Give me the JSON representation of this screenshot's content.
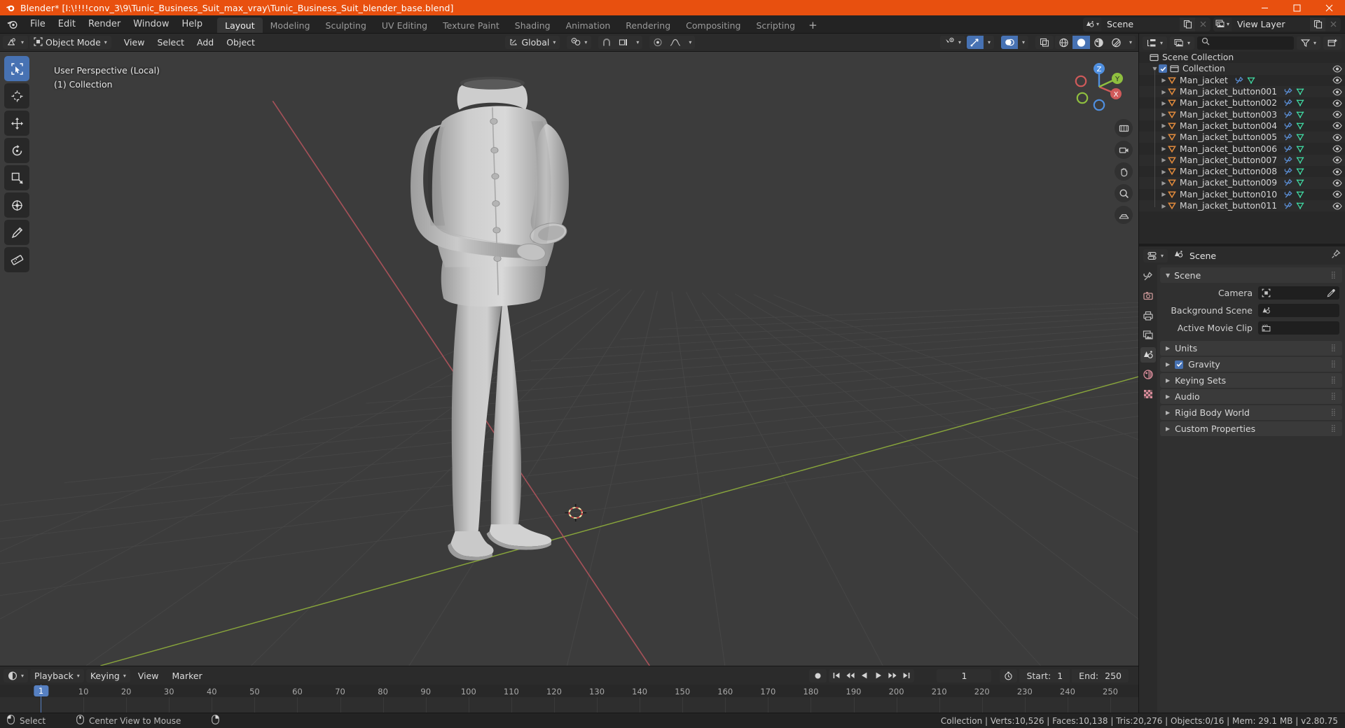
{
  "titlebar": {
    "text": "Blender* [I:\\!!!!conv_3\\9\\Tunic_Business_Suit_max_vray\\Tunic_Business_Suit_blender_base.blend]",
    "logo_icon": "blender-logo-icon",
    "minimize_icon": "minimize-icon",
    "maximize_icon": "maximize-icon",
    "close_icon": "close-icon",
    "bg_color": "#e8500f"
  },
  "topbar": {
    "logo_icon": "blender-logo-icon",
    "menus": [
      "File",
      "Edit",
      "Render",
      "Window",
      "Help"
    ],
    "workspace_tabs": [
      {
        "label": "Layout",
        "active": true
      },
      {
        "label": "Modeling",
        "active": false
      },
      {
        "label": "Sculpting",
        "active": false
      },
      {
        "label": "UV Editing",
        "active": false
      },
      {
        "label": "Texture Paint",
        "active": false
      },
      {
        "label": "Shading",
        "active": false
      },
      {
        "label": "Animation",
        "active": false
      },
      {
        "label": "Rendering",
        "active": false
      },
      {
        "label": "Compositing",
        "active": false
      },
      {
        "label": "Scripting",
        "active": false
      }
    ],
    "add_workspace_label": "+",
    "scene": {
      "icon": "scene-icon",
      "name": "Scene",
      "copy_icon": "new-scene-icon",
      "unlink_icon": "unlink-icon"
    },
    "view_layer": {
      "icon": "view-layer-icon",
      "name": "View Layer",
      "copy_icon": "new-view-layer-icon",
      "unlink_icon": "unlink-icon"
    }
  },
  "viewport_header": {
    "editor_type_icon": "editor-type-3dview-icon",
    "mode": "Object Mode",
    "mode_icon": "object-mode-icon",
    "menus": [
      "View",
      "Select",
      "Add",
      "Object"
    ],
    "transform_orientation": {
      "icon": "orientation-global-icon",
      "label": "Global"
    },
    "pivot_icon": "pivot-point-icon",
    "snap_icon": "snap-magnet-icon",
    "snap_target_icon": "snap-increment-icon",
    "proportional_icon": "proportional-editing-icon",
    "falloff_icon": "falloff-smooth-icon",
    "visibility_icon": "object-visibility-icon",
    "gizmo_icon": "gizmo-icon",
    "overlays_icon": "overlays-icon",
    "xray_icon": "xray-toggle-icon",
    "shading_modes": [
      {
        "name": "wireframe",
        "icon": "shading-wireframe-icon",
        "active": false
      },
      {
        "name": "solid",
        "icon": "shading-solid-icon",
        "active": true
      },
      {
        "name": "material",
        "icon": "shading-material-icon",
        "active": false
      },
      {
        "name": "rendered",
        "icon": "shading-rendered-icon",
        "active": false
      }
    ]
  },
  "viewport": {
    "overlay_line1": "User Perspective (Local)",
    "overlay_line2": "(1) Collection",
    "background_color": "#3c3c3c",
    "grid_color": "#4a4a4a",
    "axis_x_color": "#c75b64",
    "axis_y_color": "#9acd32",
    "tools": [
      {
        "name": "tweak-select-box-tool",
        "icon": "select-box-icon",
        "active": true
      },
      {
        "name": "cursor-tool",
        "icon": "3d-cursor-icon",
        "active": false
      },
      {
        "name": "move-tool",
        "icon": "move-arrows-icon",
        "active": false
      },
      {
        "name": "rotate-tool",
        "icon": "rotate-icon",
        "active": false
      },
      {
        "name": "scale-tool",
        "icon": "scale-icon",
        "active": false
      },
      {
        "name": "transform-tool",
        "icon": "transform-icon",
        "active": false
      },
      {
        "name": "annotate-tool",
        "icon": "annotate-pencil-icon",
        "active": false
      },
      {
        "name": "measure-tool",
        "icon": "measure-ruler-icon",
        "active": false
      }
    ],
    "gizmo": {
      "axis_labels": [
        "X",
        "Y",
        "Z"
      ],
      "x_color": "#e05a5a",
      "y_color": "#8fbf3f",
      "z_color": "#4f8fe0"
    },
    "nav_buttons": [
      {
        "name": "zoom-region-button",
        "icon": "zoom-icon"
      },
      {
        "name": "camera-view-button",
        "icon": "camera-icon"
      },
      {
        "name": "move-view-button",
        "icon": "hand-icon"
      },
      {
        "name": "zoom-view-button",
        "icon": "magnifier-icon"
      },
      {
        "name": "toggle-perspective-button",
        "icon": "perspective-grid-icon"
      }
    ]
  },
  "timeline": {
    "editor_type_icon": "editor-type-timeline-icon",
    "menus": [
      "Playback",
      "Keying",
      "View",
      "Marker"
    ],
    "record_icon": "record-keyframe-icon",
    "transport": [
      {
        "name": "jump-to-start-button",
        "icon": "jump-start-icon"
      },
      {
        "name": "previous-keyframe-button",
        "icon": "prev-keyframe-icon"
      },
      {
        "name": "play-reverse-button",
        "icon": "play-reverse-icon"
      },
      {
        "name": "play-button",
        "icon": "play-icon"
      },
      {
        "name": "next-keyframe-button",
        "icon": "next-keyframe-icon"
      },
      {
        "name": "jump-to-end-button",
        "icon": "jump-end-icon"
      }
    ],
    "current_frame": "1",
    "use_preview_range_icon": "stopwatch-icon",
    "start_label": "Start:",
    "start_value": "1",
    "end_label": "End:",
    "end_value": "250",
    "ruler_ticks": [
      "1",
      "10",
      "20",
      "30",
      "40",
      "50",
      "60",
      "70",
      "80",
      "90",
      "100",
      "110",
      "120",
      "130",
      "140",
      "150",
      "160",
      "170",
      "180",
      "190",
      "200",
      "210",
      "220",
      "230",
      "240",
      "250"
    ],
    "playhead_frame": "1",
    "playhead_color": "#5680c2"
  },
  "outliner": {
    "display_mode_icon": "outliner-display-mode-icon",
    "view_layer_icon": "view-layer-icon",
    "search_icon": "search-icon",
    "search_placeholder": "",
    "search_value": "",
    "filter_icon": "filter-funnel-icon",
    "new_collection_icon": "new-collection-icon",
    "rows": [
      {
        "label": "Scene Collection",
        "depth": 0,
        "icon": "scene-collection-icon",
        "expander": "",
        "checkbox": false,
        "modifier": false,
        "mesh": false,
        "eye": false
      },
      {
        "label": "Collection",
        "depth": 1,
        "icon": "collection-icon",
        "expander": "down",
        "checkbox": true,
        "modifier": false,
        "mesh": false,
        "eye": true
      },
      {
        "label": "Man_jacket",
        "depth": 2,
        "icon": "mesh-object-icon",
        "expander": "right",
        "checkbox": false,
        "modifier": true,
        "mesh": true,
        "eye": true
      },
      {
        "label": "Man_jacket_button001",
        "depth": 2,
        "icon": "mesh-object-icon",
        "expander": "right",
        "checkbox": false,
        "modifier": true,
        "mesh": true,
        "eye": true
      },
      {
        "label": "Man_jacket_button002",
        "depth": 2,
        "icon": "mesh-object-icon",
        "expander": "right",
        "checkbox": false,
        "modifier": true,
        "mesh": true,
        "eye": true
      },
      {
        "label": "Man_jacket_button003",
        "depth": 2,
        "icon": "mesh-object-icon",
        "expander": "right",
        "checkbox": false,
        "modifier": true,
        "mesh": true,
        "eye": true
      },
      {
        "label": "Man_jacket_button004",
        "depth": 2,
        "icon": "mesh-object-icon",
        "expander": "right",
        "checkbox": false,
        "modifier": true,
        "mesh": true,
        "eye": true
      },
      {
        "label": "Man_jacket_button005",
        "depth": 2,
        "icon": "mesh-object-icon",
        "expander": "right",
        "checkbox": false,
        "modifier": true,
        "mesh": true,
        "eye": true
      },
      {
        "label": "Man_jacket_button006",
        "depth": 2,
        "icon": "mesh-object-icon",
        "expander": "right",
        "checkbox": false,
        "modifier": true,
        "mesh": true,
        "eye": true
      },
      {
        "label": "Man_jacket_button007",
        "depth": 2,
        "icon": "mesh-object-icon",
        "expander": "right",
        "checkbox": false,
        "modifier": true,
        "mesh": true,
        "eye": true
      },
      {
        "label": "Man_jacket_button008",
        "depth": 2,
        "icon": "mesh-object-icon",
        "expander": "right",
        "checkbox": false,
        "modifier": true,
        "mesh": true,
        "eye": true
      },
      {
        "label": "Man_jacket_button009",
        "depth": 2,
        "icon": "mesh-object-icon",
        "expander": "right",
        "checkbox": false,
        "modifier": true,
        "mesh": true,
        "eye": true
      },
      {
        "label": "Man_jacket_button010",
        "depth": 2,
        "icon": "mesh-object-icon",
        "expander": "right",
        "checkbox": false,
        "modifier": true,
        "mesh": true,
        "eye": true
      },
      {
        "label": "Man_jacket_button011",
        "depth": 2,
        "icon": "mesh-object-icon",
        "expander": "right",
        "checkbox": false,
        "modifier": true,
        "mesh": true,
        "eye": true
      }
    ]
  },
  "properties": {
    "editor_type_icon": "editor-type-properties-icon",
    "breadcrumb_icon": "scene-icon",
    "breadcrumb": "Scene",
    "pin_icon": "pin-icon",
    "tabs": [
      {
        "name": "tool-tab",
        "icon": "tool-wrench-screwdriver-icon",
        "active": false
      },
      {
        "name": "render-tab",
        "icon": "render-camera-back-icon",
        "active": false
      },
      {
        "name": "output-tab",
        "icon": "output-printer-icon",
        "active": false
      },
      {
        "name": "view-layer-tab",
        "icon": "view-layer-images-icon",
        "active": false
      },
      {
        "name": "scene-tab",
        "icon": "scene-cone-sphere-icon",
        "active": true
      },
      {
        "name": "world-tab",
        "icon": "world-globe-icon",
        "active": false
      },
      {
        "name": "texture-tab",
        "icon": "texture-checker-icon",
        "active": false
      }
    ],
    "scene_panel_title": "Scene",
    "rows": [
      {
        "label": "Camera",
        "icon": "camera-data-icon",
        "value": "",
        "eyedropper": true
      },
      {
        "label": "Background Scene",
        "icon": "scene-icon",
        "value": "",
        "eyedropper": false
      },
      {
        "label": "Active Movie Clip",
        "icon": "movie-clip-icon",
        "value": "",
        "eyedropper": false
      }
    ],
    "panels": [
      {
        "label": "Units",
        "checkbox": false
      },
      {
        "label": "Gravity",
        "checkbox": true
      },
      {
        "label": "Keying Sets",
        "checkbox": false
      },
      {
        "label": "Audio",
        "checkbox": false
      },
      {
        "label": "Rigid Body World",
        "checkbox": false
      },
      {
        "label": "Custom Properties",
        "checkbox": false
      }
    ]
  },
  "statusbar": {
    "hints": [
      {
        "icon": "mouse-left-icon",
        "label": "Select"
      },
      {
        "icon": "mouse-middle-icon",
        "label": "Center View to Mouse"
      },
      {
        "icon": "mouse-right-icon",
        "label": ""
      }
    ],
    "stats": "Collection | Verts:10,526 | Faces:10,138 | Tris:20,276 | Objects:0/16 | Mem: 29.1 MB | v2.80.75"
  }
}
